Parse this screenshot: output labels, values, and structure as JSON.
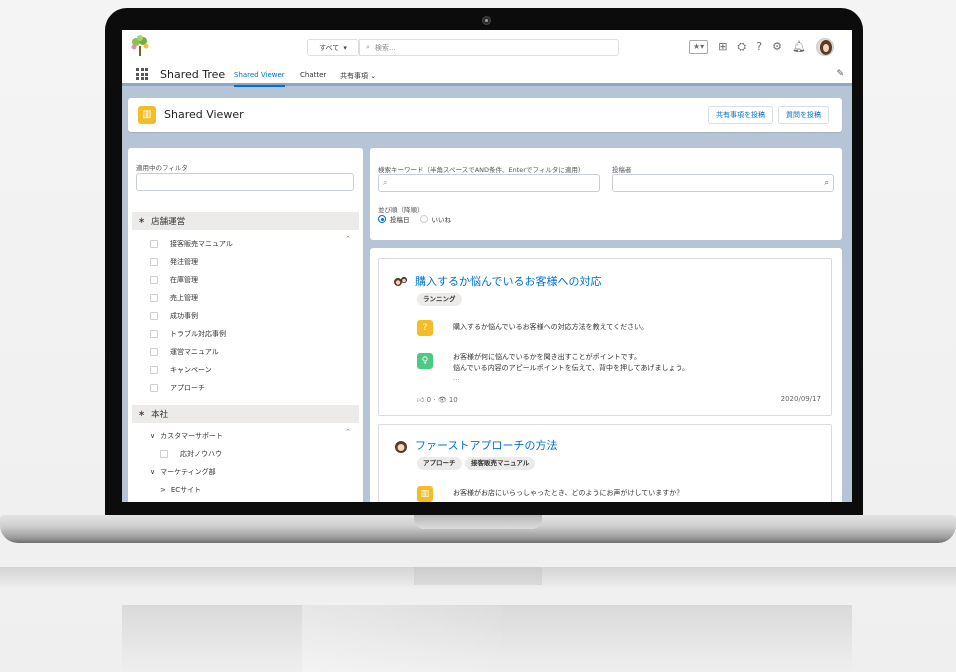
{
  "header": {
    "scope_label": "すべて",
    "search_placeholder": "検索..."
  },
  "nav": {
    "app_name": "Shared Tree",
    "tabs": [
      {
        "label": "Shared Viewer",
        "active": true
      },
      {
        "label": "Chatter",
        "active": false
      },
      {
        "label": "共有事項",
        "active": false
      }
    ]
  },
  "page": {
    "title": "Shared Viewer",
    "buttons": [
      "共有事項を投稿",
      "質問を投稿"
    ]
  },
  "filters": {
    "active_label": "適用中のフィルタ",
    "groups": [
      {
        "name": "店舗運営",
        "items": [
          "接客販売マニュアル",
          "発注管理",
          "在庫管理",
          "売上管理",
          "成功事例",
          "トラブル対応事例",
          "運営マニュアル",
          "キャンペーン",
          "アプローチ"
        ]
      },
      {
        "name": "本社",
        "tree": [
          {
            "label": "カスタマーサポート",
            "chevron": "∨",
            "children": [
              "応対ノウハウ"
            ]
          },
          {
            "label": "マーケティング部",
            "chevron": "∨"
          },
          {
            "label": "ECサイト",
            "chevron": ">"
          }
        ]
      }
    ]
  },
  "search": {
    "keyword_label": "検索キーワード（半角スペースでAND条件、Enterでフィルタに適用）",
    "poster_label": "投稿者",
    "sort_label": "並び順（降順）",
    "sort_options": [
      {
        "label": "投稿日",
        "selected": true
      },
      {
        "label": "いいね",
        "selected": false
      }
    ]
  },
  "posts": [
    {
      "title": "購入するか悩んでいるお客様への対応",
      "tags": [
        "ランニング"
      ],
      "question": "購入するか悩んでいるお客様への対応方法を教えてください。",
      "answer_lines": [
        "お客様が何に悩んでいるかを聞き出すことがポイントです。",
        "悩んでいる内容のアピールポイントを伝えて、背中を押してあげましょう。",
        "..."
      ],
      "likes": "0",
      "views": "10",
      "date": "2020/09/17"
    },
    {
      "title": "ファーストアプローチの方法",
      "tags": [
        "アプローチ",
        "接客販売マニュアル"
      ],
      "question": "お客様がお店にいらっしゃったとき、どのようにお声がけしていますか？"
    }
  ],
  "colors": {
    "brand_blue": "#0070d2",
    "page_icon": "#f4bc25",
    "answer_icon": "#4bca81",
    "banner": "#b6c5d6"
  },
  "icons": [
    "tree-logo-icon",
    "search-icon",
    "favorites-icon",
    "add-icon",
    "trailhead-icon",
    "help-icon",
    "setup-gear-icon",
    "bell-icon",
    "waffle-icon",
    "pencil-icon",
    "question-icon",
    "lightbulb-icon",
    "thumbs-up-icon",
    "eye-icon"
  ]
}
